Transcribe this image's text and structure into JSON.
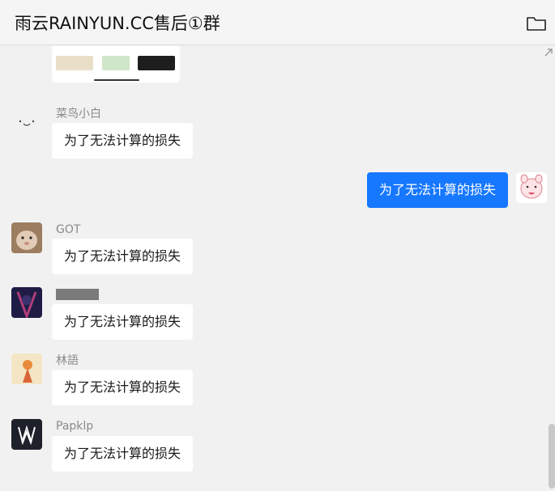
{
  "header": {
    "title": "雨云RAINYUN.CC售后①群",
    "folder_icon": "folder-icon"
  },
  "messages": [
    {
      "type": "image",
      "from": "unknown",
      "icons": [
        "forward-arrow-icon"
      ]
    },
    {
      "type": "text",
      "sender": "菜鸟小白",
      "text": "为了无法计算的损失",
      "avatar": "face-doodle-avatar"
    },
    {
      "type": "text",
      "sender": "self",
      "text": "为了无法计算的损失",
      "avatar": "pink-cartoon-avatar",
      "colors": {
        "bubble": "#1677ff"
      }
    },
    {
      "type": "text",
      "sender": "GOT",
      "text": "为了无法计算的损失",
      "avatar": "cat-photo-avatar"
    },
    {
      "type": "text",
      "sender": "",
      "text": "为了无法计算的损失",
      "avatar": "anime-avatar",
      "sender_redacted": true
    },
    {
      "type": "text",
      "sender": "林語",
      "text": "为了无法计算的损失",
      "avatar": "girl-illustration-avatar"
    },
    {
      "type": "text",
      "sender": "Papklp",
      "text": "为了无法计算的损失",
      "avatar": "aw-logo-avatar"
    }
  ],
  "colors": {
    "background": "#f1f1f1",
    "bubble_other": "#ffffff",
    "bubble_self": "#1677ff",
    "sender_name": "#8a8a8a"
  }
}
